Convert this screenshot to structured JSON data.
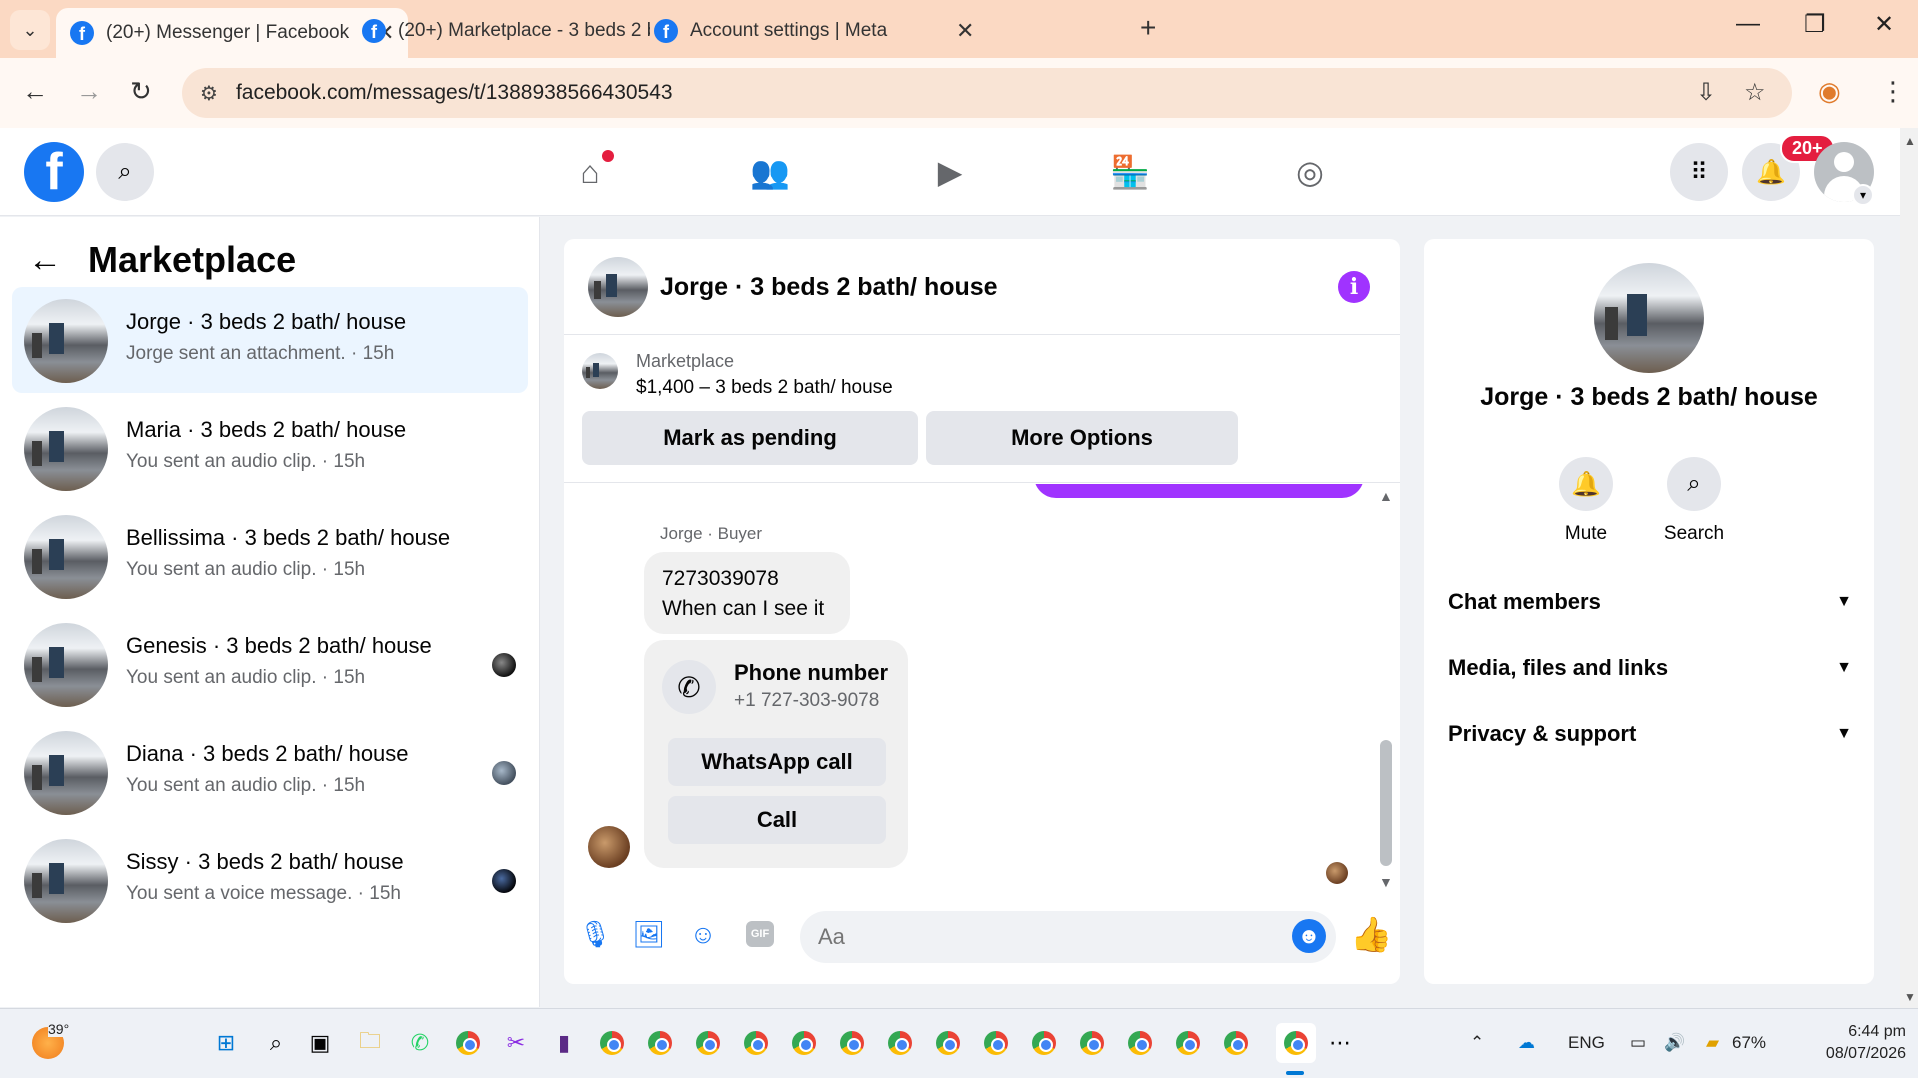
{
  "browser": {
    "tabs": [
      {
        "title": "(20+) Messenger | Facebook",
        "active": true
      },
      {
        "title": "(20+) Marketplace - 3 beds 2 b",
        "active": false
      },
      {
        "title": "Account settings | Meta",
        "active": false
      }
    ],
    "url": "facebook.com/messages/t/1388938566430543"
  },
  "header": {
    "notification_badge": "20+"
  },
  "sidebar": {
    "title": "Marketplace",
    "conversations": [
      {
        "name": "Jorge · 3 beds 2 bath/ house",
        "preview": "Jorge sent an attachment. · 15h"
      },
      {
        "name": "Maria · 3 beds 2 bath/ house",
        "preview": "You sent an audio clip. · 15h"
      },
      {
        "name": "Bellissima · 3 beds 2 bath/ house",
        "preview": "You sent an audio clip. · 15h"
      },
      {
        "name": "Genesis · 3 beds 2 bath/ house",
        "preview": "You sent an audio clip. · 15h"
      },
      {
        "name": "Diana · 3 beds 2 bath/ house",
        "preview": "You sent an audio clip. · 15h"
      },
      {
        "name": "Sissy · 3 beds 2 bath/ house",
        "preview": "You sent a voice message. · 15h"
      }
    ]
  },
  "chat": {
    "title": "Jorge · 3 beds 2 bath/ house",
    "marketplace_label": "Marketplace",
    "listing": "$1,400 – 3 beds 2 bath/ house",
    "mark_pending": "Mark as pending",
    "more_options": "More Options",
    "sender_label": "Jorge · Buyer",
    "message_line1": "7273039078",
    "message_line2": "When can I see it",
    "phone_card_title": "Phone number",
    "phone_card_value": "+1 727-303-9078",
    "whatsapp_call": "WhatsApp call",
    "call": "Call",
    "input_placeholder": "Aa"
  },
  "details": {
    "title": "Jorge · 3 beds 2 bath/ house",
    "mute": "Mute",
    "search": "Search",
    "sections": [
      "Chat members",
      "Media, files and links",
      "Privacy & support"
    ]
  },
  "taskbar": {
    "temperature": "39°",
    "language": "ENG",
    "battery": "67%",
    "time": "6:44 pm",
    "date": "08/07/2026"
  },
  "colors": {
    "accent": "#1877f2",
    "messenger_purple": "#a033ff",
    "active_conv": "#ebf5ff"
  }
}
